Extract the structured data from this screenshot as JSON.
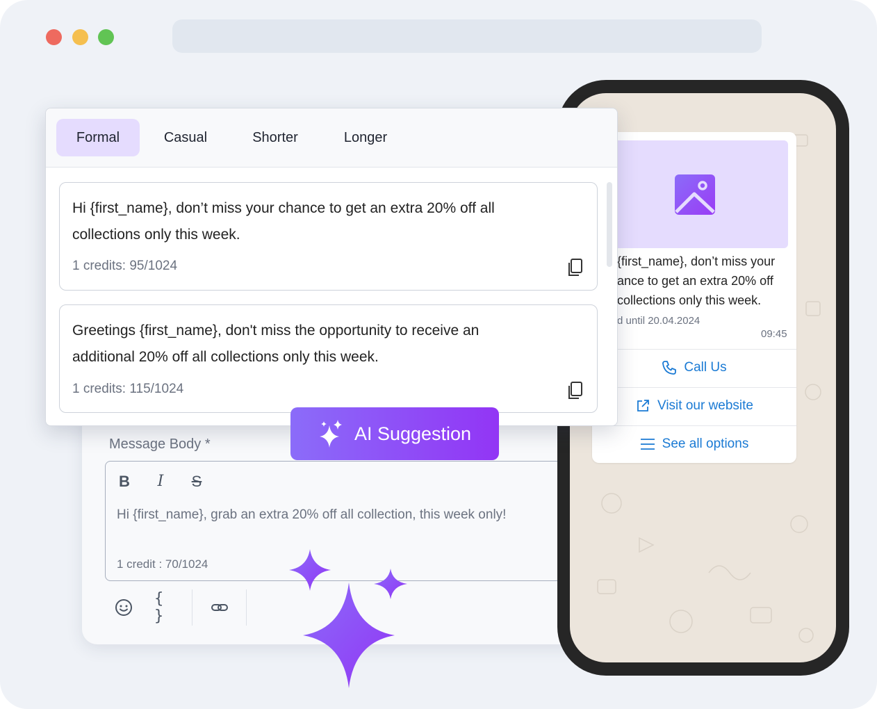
{
  "tabs": [
    "Formal",
    "Casual",
    "Shorter",
    "Longer"
  ],
  "suggestions": [
    {
      "line1": "Hi {first_name}, don’t miss your chance to get an extra 20% off all",
      "line2": "collections only this week.",
      "credits": "1 credits: 95/1024"
    },
    {
      "line1": "Greetings {first_name}, don't miss the opportunity to receive an",
      "line2": "additional 20% off all collections only this week.",
      "credits": "1 credits: 115/1024"
    }
  ],
  "ai_button": {
    "label": "AI Suggestion",
    "icon": "sparkles-icon"
  },
  "editor": {
    "label": "Message Body *",
    "format_buttons": [
      "B",
      "I",
      "S"
    ],
    "text": "Hi {first_name}, grab an extra 20% off all collection, this week only!",
    "credit": "1 credit : 70/1024",
    "tools": [
      "smiley-icon",
      "curly-braces-icon",
      "link-icon"
    ],
    "braces_glyph": "{ }"
  },
  "phone_preview": {
    "lines": [
      "{first_name}, don’t miss your",
      "ance to get an extra 20% off",
      "collections only this week."
    ],
    "validity": "d until 20.04.2024",
    "time": "09:45",
    "buttons": [
      {
        "label": "Call Us",
        "icon": "phone-icon"
      },
      {
        "label": "Visit our website",
        "icon": "external-link-icon"
      },
      {
        "label": "See all options",
        "icon": "list-icon"
      }
    ]
  },
  "colors": {
    "accent": "#9235f5",
    "accent_light": "#e5dcfe",
    "link_blue": "#1a7ad4",
    "phone_bg": "#ece5dc"
  }
}
